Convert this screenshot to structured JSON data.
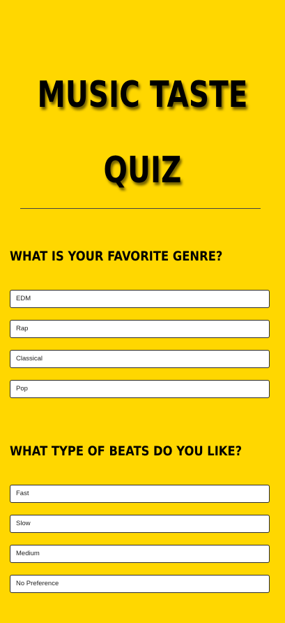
{
  "title": {
    "line1": "MUSIC TASTE",
    "line2": "QUIZ"
  },
  "questions": [
    {
      "prompt": "WHAT IS YOUR FAVORITE GENRE?",
      "options": [
        "EDM",
        "Rap",
        "Classical",
        "Pop"
      ]
    },
    {
      "prompt": "WHAT TYPE OF BEATS DO YOU LIKE?",
      "options": [
        "Fast",
        "Slow",
        "Medium",
        "No Preference"
      ]
    }
  ],
  "colors": {
    "background": "#ffd700",
    "text": "#000000",
    "option_background": "#ffffff"
  }
}
